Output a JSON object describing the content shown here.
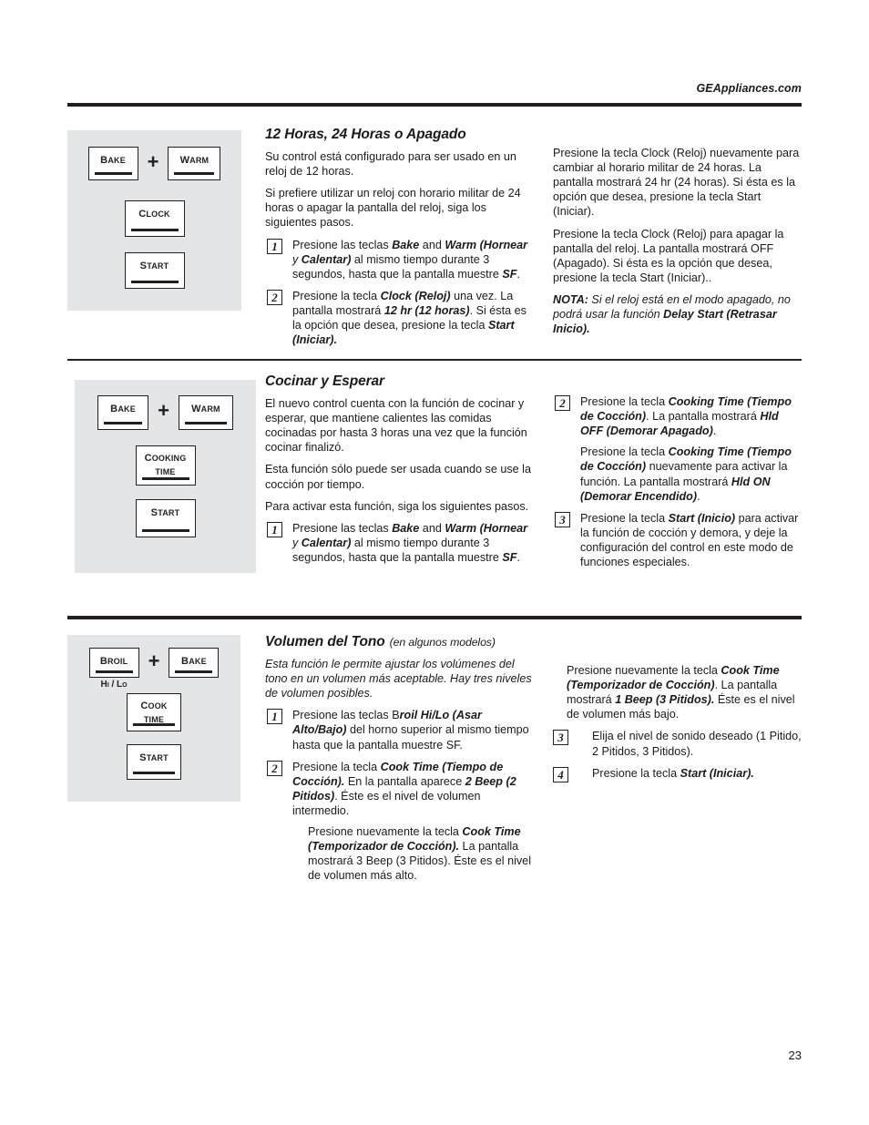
{
  "header": {
    "site": "GEAppliances.com"
  },
  "page": {
    "number": "23"
  },
  "sections": [
    {
      "id": "twelve-hour",
      "title": "12 Horas, 24 Horas o Apagado",
      "keypad": {
        "combo": [
          {
            "label": "Bake",
            "lines": [
              "Bake"
            ]
          },
          {
            "label": "Warm",
            "lines": [
              "Warm"
            ]
          }
        ],
        "plus": "+",
        "keys": [
          {
            "label": "Clock",
            "lines": [
              "Clock"
            ]
          },
          {
            "label": "Start",
            "lines": [
              "Start"
            ]
          }
        ]
      },
      "left": {
        "paras": [
          "Su control está configurado para ser usado en un reloj de 12 horas.",
          "Si prefiere utilizar un reloj con horario militar de 24 horas o apagar la pantalla del reloj, siga los siguientes pasos."
        ],
        "steps": [
          {
            "num": "1",
            "text_parts": [
              {
                "t": "Presione las teclas ",
                "s": "n"
              },
              {
                "t": "Bake",
                "s": "bi"
              },
              {
                "t": " and ",
                "s": "n"
              },
              {
                "t": "Warm (Hornear",
                "s": "bi"
              },
              {
                "t": " y ",
                "s": "i"
              },
              {
                "t": "Calentar)",
                "s": "bi"
              },
              {
                "t": " al mismo tiempo durante 3 segundos, hasta que la pantalla muestre ",
                "s": "n"
              },
              {
                "t": "SF",
                "s": "bi"
              },
              {
                "t": ".",
                "s": "n"
              }
            ]
          },
          {
            "num": "2",
            "text_parts": [
              {
                "t": "Presione la tecla ",
                "s": "n"
              },
              {
                "t": "Clock (Reloj)",
                "s": "bi"
              },
              {
                "t": " una vez. La pantalla mostrará ",
                "s": "n"
              },
              {
                "t": "12 hr (12 horas)",
                "s": "bi"
              },
              {
                "t": ". Si ésta es la opción que desea, presione la tecla ",
                "s": "n"
              },
              {
                "t": "Start (Iniciar).",
                "s": "bi"
              }
            ]
          }
        ]
      },
      "right": {
        "paras": [
          "Presione la tecla Clock (Reloj) nuevamente para cambiar al horario militar de 24 horas. La pantalla mostrará 24 hr (24 horas). Si ésta es la opción que desea, presione la tecla Start (Iniciar).",
          "Presione la tecla Clock (Reloj) para apagar la pantalla del reloj. La pantalla mostrará OFF (Apagado). Si ésta es la opción que desea, presione la tecla Start (Iniciar).."
        ],
        "note": {
          "label": "NOTA:",
          "body_pre": " Si el reloj está en el modo apagado, no podrá usar la función ",
          "body_bold": "Delay Start (Retrasar Inicio).",
          "body_post": ""
        }
      }
    },
    {
      "id": "cook-and-hold",
      "title": "Cocinar y Esperar",
      "keypad": {
        "combo": [
          {
            "label": "Bake",
            "lines": [
              "Bake"
            ]
          },
          {
            "label": "Warm",
            "lines": [
              "Warm"
            ]
          }
        ],
        "plus": "+",
        "keys": [
          {
            "label": "Cooking Time",
            "lines": [
              "Cooking",
              "Time"
            ]
          },
          {
            "label": "Start",
            "lines": [
              "Start"
            ]
          }
        ]
      },
      "left": {
        "paras": [
          "El nuevo control cuenta con la función de cocinar y esperar, que mantiene calientes las comidas cocinadas por hasta 3 horas una vez que la función cocinar finalizó.",
          "Esta función sólo puede ser usada cuando se use la cocción por tiempo.",
          "Para activar esta función, siga los siguientes pasos."
        ],
        "steps": [
          {
            "num": "1",
            "text_parts": [
              {
                "t": "Presione las teclas ",
                "s": "n"
              },
              {
                "t": "Bake",
                "s": "bi"
              },
              {
                "t": " and ",
                "s": "n"
              },
              {
                "t": "Warm (Hornear",
                "s": "bi"
              },
              {
                "t": " y ",
                "s": "i"
              },
              {
                "t": "Calentar)",
                "s": "bi"
              },
              {
                "t": " al mismo tiempo durante 3 segundos, hasta que la pantalla muestre ",
                "s": "n"
              },
              {
                "t": "SF",
                "s": "bi"
              },
              {
                "t": ".",
                "s": "n"
              }
            ]
          }
        ]
      },
      "right": {
        "steps": [
          {
            "num": "2",
            "text_parts": [
              {
                "t": "Presione la tecla ",
                "s": "n"
              },
              {
                "t": "Cooking Time (Tiempo de Cocción)",
                "s": "bi"
              },
              {
                "t": ". La pantalla mostrará ",
                "s": "n"
              },
              {
                "t": "Hld OFF (Demorar Apagado)",
                "s": "bi"
              },
              {
                "t": ".",
                "s": "n"
              }
            ],
            "sub_parts": [
              {
                "t": "Presione la tecla ",
                "s": "n"
              },
              {
                "t": "Cooking Time (Tiempo de Cocción)",
                "s": "bi"
              },
              {
                "t": " nuevamente para activar la función. La pantalla mostrará ",
                "s": "n"
              },
              {
                "t": "Hld ON (Demorar Encendido)",
                "s": "bi"
              },
              {
                "t": ".",
                "s": "n"
              }
            ]
          },
          {
            "num": "3",
            "text_parts": [
              {
                "t": "Presione la tecla ",
                "s": "n"
              },
              {
                "t": "Start (Inicio)",
                "s": "bi"
              },
              {
                "t": " para activar la función de cocción y demora, y deje la configuración del control en este modo de funciones especiales.",
                "s": "n"
              }
            ]
          }
        ]
      }
    },
    {
      "id": "tone-volume",
      "title": "Volumen del Tono",
      "subtitle": "(en algunos modelos)",
      "keypad": {
        "combo": [
          {
            "label": "Broil Hi/Lo",
            "lines": [
              "Broil"
            ],
            "caption": "Hi / Lo"
          },
          {
            "label": "Bake",
            "lines": [
              "Bake"
            ]
          }
        ],
        "plus": "+",
        "keys": [
          {
            "label": "Cook Time",
            "lines": [
              "Cook",
              "Time"
            ]
          },
          {
            "label": "Start",
            "lines": [
              "Start"
            ]
          }
        ]
      },
      "left": {
        "paras": [
          "Esta función le permite ajustar los volúmenes del tono en un volumen más aceptable. Hay tres niveles de volumen posibles."
        ],
        "steps": [
          {
            "num": "1",
            "text_parts": [
              {
                "t": "Presione las teclas B",
                "s": "n"
              },
              {
                "t": "roil Hi/Lo (Asar Alto/Bajo)",
                "s": "bi"
              },
              {
                "t": " del horno superior al mismo tiempo hasta que la pantalla muestre SF.",
                "s": "n"
              }
            ]
          },
          {
            "num": "2",
            "text_parts": [
              {
                "t": "Presione la tecla ",
                "s": "n"
              },
              {
                "t": "Cook Time (Tiempo de Cocción).",
                "s": "bi"
              },
              {
                "t": " En la pantalla aparece ",
                "s": "n"
              },
              {
                "t": "2 Beep (2 Pitidos)",
                "s": "bi"
              },
              {
                "t": ". Éste es el nivel de volumen intermedio.",
                "s": "n"
              }
            ],
            "sub_parts": [
              {
                "t": "Presione nuevamente la tecla ",
                "s": "n"
              },
              {
                "t": "Cook Time (Temporizador de Cocción).",
                "s": "bi"
              },
              {
                "t": " La pantalla mostrará 3 Beep (3 Pitidos). Éste es el nivel de volumen más alto.",
                "s": "n"
              }
            ]
          }
        ]
      },
      "right": {
        "lead_parts": [
          {
            "t": "Presione nuevamente la tecla ",
            "s": "n"
          },
          {
            "t": "Cook Time (Temporizador de Cocción)",
            "s": "bi"
          },
          {
            "t": ". La pantalla mostrará ",
            "s": "n"
          },
          {
            "t": "1 Beep (3 Pitidos).",
            "s": "bi"
          },
          {
            "t": " Éste es el nivel de volumen más bajo.",
            "s": "n"
          }
        ],
        "steps": [
          {
            "num": "3",
            "text_parts": [
              {
                "t": " Elija el nivel de sonido deseado (1 Pitido, 2 Pitidos, 3 Pitidos).",
                "s": "n"
              }
            ]
          },
          {
            "num": "4",
            "text_parts": [
              {
                "t": " Presione la tecla ",
                "s": "n"
              },
              {
                "t": "Start (Iniciar).",
                "s": "bi"
              }
            ]
          }
        ]
      }
    }
  ]
}
